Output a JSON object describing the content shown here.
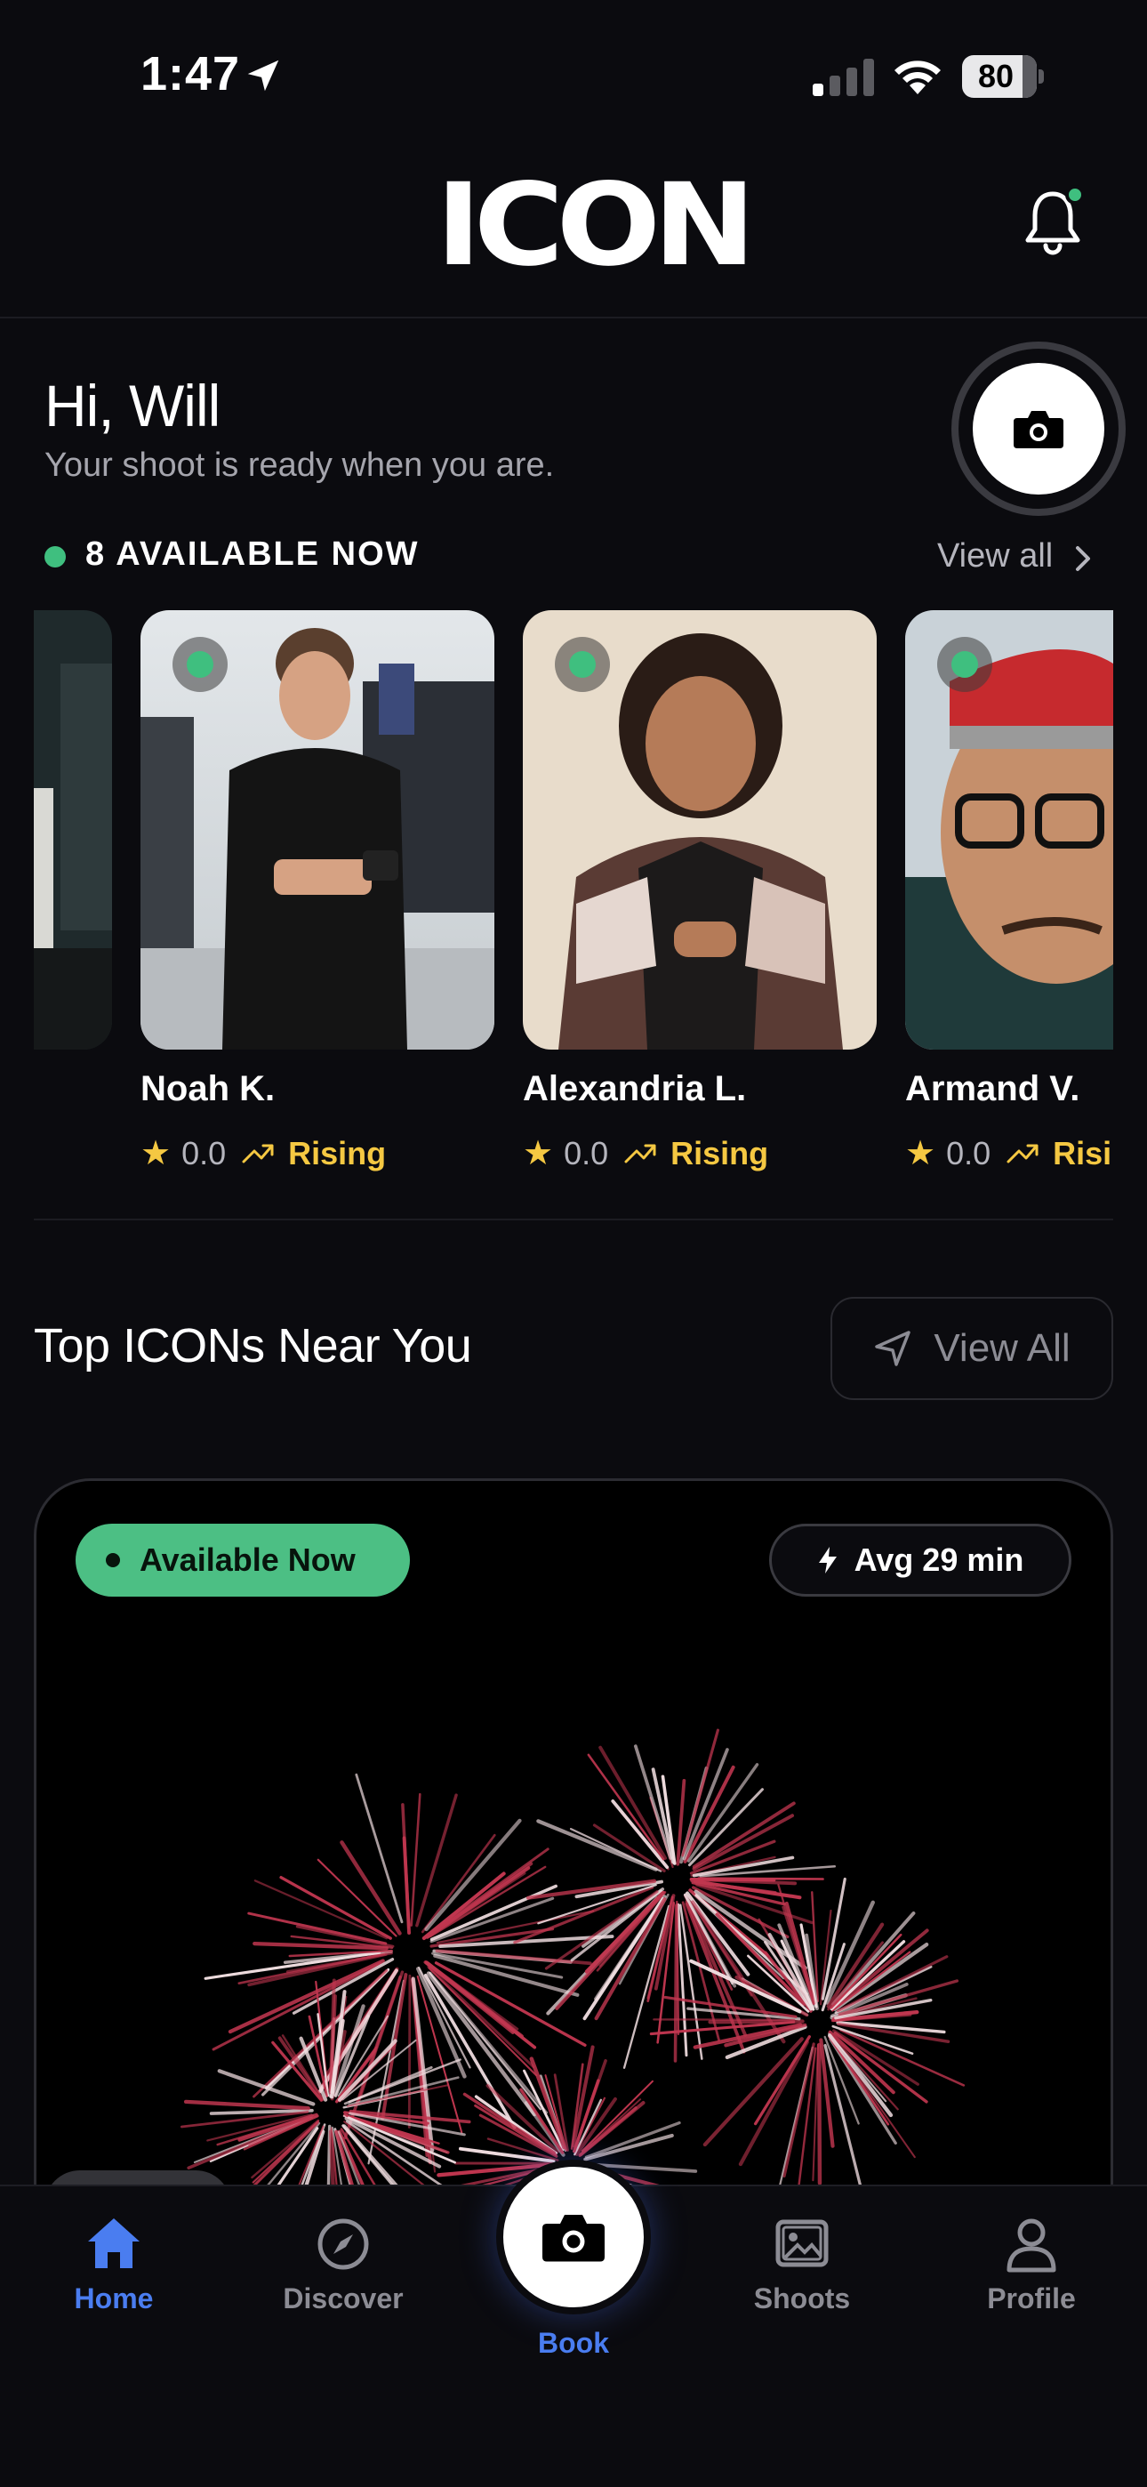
{
  "status_bar": {
    "time": "1:47",
    "battery": "80"
  },
  "header": {
    "logo": "ICON"
  },
  "greeting": {
    "title": "Hi, Will",
    "subtitle": "Your shoot is ready when you are."
  },
  "available": {
    "label": "8 AVAILABLE NOW",
    "view_all": "View all"
  },
  "photographers": [
    {
      "name": "Noah K.",
      "rating": "0.0",
      "status": "Rising"
    },
    {
      "name": "Alexandria L.",
      "rating": "0.0",
      "status": "Rising"
    },
    {
      "name": "Armand V.",
      "rating": "0.0",
      "status": "Risi"
    }
  ],
  "top_icons": {
    "title": "Top ICONs Near You",
    "view_all": "View All",
    "featured": {
      "availability": "Available Now",
      "avg": "Avg 29 min"
    }
  },
  "tabs": [
    {
      "label": "Home",
      "icon": "home-icon",
      "active": true
    },
    {
      "label": "Discover",
      "icon": "compass-icon",
      "active": false
    },
    {
      "label": "Book",
      "icon": "camera-icon",
      "active": false
    },
    {
      "label": "Shoots",
      "icon": "photos-icon",
      "active": false
    },
    {
      "label": "Profile",
      "icon": "person-icon",
      "active": false
    }
  ],
  "colors": {
    "accent": "#4a7df0",
    "available": "#3fbf7f",
    "rising": "#f5c842"
  }
}
